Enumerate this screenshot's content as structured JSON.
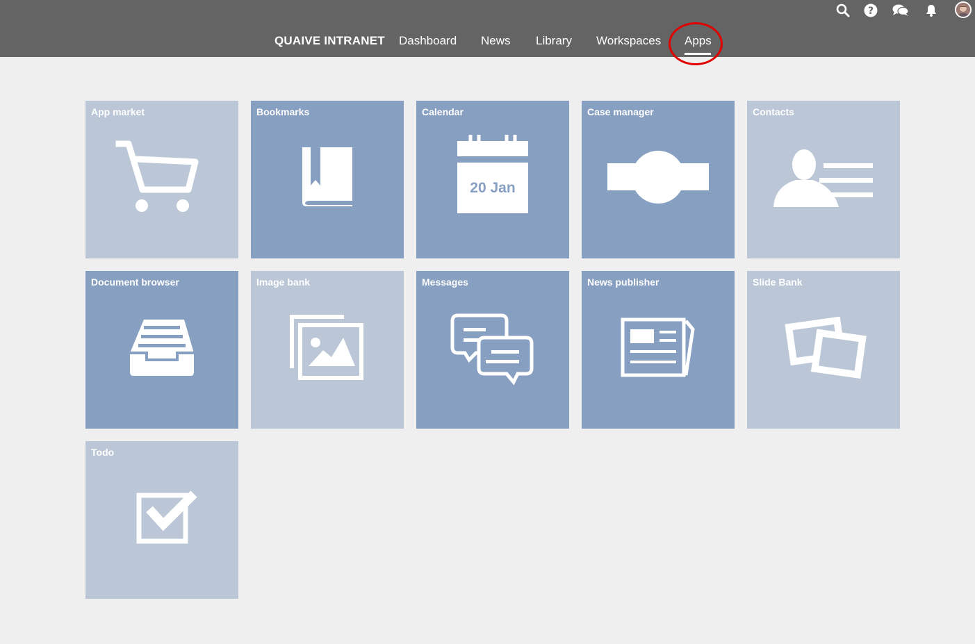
{
  "nav": {
    "brand": "QUAIVE INTRANET",
    "items": [
      {
        "label": "Dashboard"
      },
      {
        "label": "News"
      },
      {
        "label": "Library"
      },
      {
        "label": "Workspaces"
      },
      {
        "label": "Apps",
        "active": true
      }
    ]
  },
  "toolbar": {
    "icons": [
      "search-icon",
      "help-icon",
      "chat-icon",
      "bell-icon",
      "avatar"
    ]
  },
  "apps": [
    {
      "title": "App market",
      "icon": "cart-icon",
      "shade": "light"
    },
    {
      "title": "Bookmarks",
      "icon": "bookmark-book-icon",
      "shade": "dark"
    },
    {
      "title": "Calendar",
      "icon": "calendar-icon",
      "shade": "dark",
      "date": "20 Jan"
    },
    {
      "title": "Case manager",
      "icon": "case-icon",
      "shade": "dark"
    },
    {
      "title": "Contacts",
      "icon": "contact-card-icon",
      "shade": "light"
    },
    {
      "title": "Document browser",
      "icon": "file-tray-icon",
      "shade": "dark"
    },
    {
      "title": "Image bank",
      "icon": "images-icon",
      "shade": "light"
    },
    {
      "title": "Messages",
      "icon": "chat-bubbles-icon",
      "shade": "dark"
    },
    {
      "title": "News publisher",
      "icon": "newspaper-icon",
      "shade": "dark"
    },
    {
      "title": "Slide Bank",
      "icon": "slides-icon",
      "shade": "light"
    },
    {
      "title": "Todo",
      "icon": "checkbox-icon",
      "shade": "light"
    }
  ],
  "colors": {
    "topbar": "#646464",
    "tile_dark": "#879fc1",
    "tile_light": "#bbc6d6",
    "background": "#efefef",
    "highlight": "#e00000"
  }
}
